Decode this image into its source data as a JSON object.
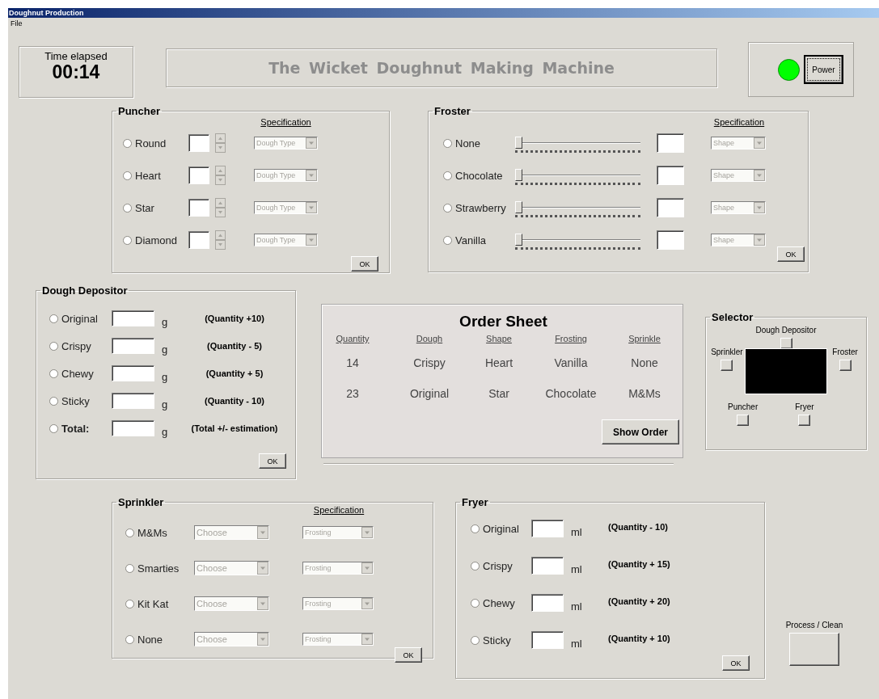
{
  "window": {
    "title": "Doughnut Production"
  },
  "menu": [
    "File"
  ],
  "timer": {
    "label": "Time elapsed",
    "value": "00:14"
  },
  "banner": {
    "title": "The Wicket Doughnut Making Machine"
  },
  "power": {
    "on": true,
    "button": "Power"
  },
  "puncher": {
    "title": "Puncher",
    "spec_heading": "Specification",
    "ok": "OK",
    "rows": [
      {
        "label": "Round",
        "checked": false,
        "dropdown": {
          "value": "Dough Type",
          "disabled": true
        }
      },
      {
        "label": "Heart",
        "checked": false,
        "dropdown": {
          "value": "Dough Type",
          "disabled": true
        }
      },
      {
        "label": "Star",
        "checked": false,
        "dropdown": {
          "value": "Dough Type",
          "disabled": true
        }
      },
      {
        "label": "Diamond",
        "checked": false,
        "dropdown": {
          "value": "Dough Type",
          "disabled": true
        }
      }
    ]
  },
  "froster": {
    "title": "Froster",
    "spec_heading": "Specification",
    "ok": "OK",
    "rows": [
      {
        "label": "None",
        "checked": false,
        "level": 0,
        "dropdown": {
          "value": "Shape",
          "disabled": true
        }
      },
      {
        "label": "Chocolate",
        "checked": false,
        "level": 0,
        "dropdown": {
          "value": "Shape",
          "disabled": true
        }
      },
      {
        "label": "Strawberry",
        "checked": false,
        "level": 0,
        "dropdown": {
          "value": "Shape",
          "disabled": true
        }
      },
      {
        "label": "Vanilla",
        "checked": false,
        "level": 0,
        "dropdown": {
          "value": "Shape",
          "disabled": true
        }
      }
    ]
  },
  "dough_depositor": {
    "title": "Dough Depositor",
    "ok": "OK",
    "rows": [
      {
        "kind": "item",
        "label": "Original",
        "checked": false,
        "unit": "g",
        "note": "(Quantity +10)"
      },
      {
        "kind": "item",
        "label": "Crispy",
        "checked": false,
        "unit": "g",
        "note": "(Quantity - 5)"
      },
      {
        "kind": "item",
        "label": "Chewy",
        "checked": false,
        "unit": "g",
        "note": "(Quantity + 5)"
      },
      {
        "kind": "item",
        "label": "Sticky",
        "checked": false,
        "unit": "g",
        "note": "(Quantity - 10)"
      },
      {
        "kind": "total",
        "label": "Total:",
        "checked": false,
        "unit": "g",
        "note": "(Total +/- estimation)"
      }
    ]
  },
  "order_sheet": {
    "title": "Order Sheet",
    "columns": [
      "Quantity",
      "Dough",
      "Shape",
      "Frosting",
      "Sprinkle"
    ],
    "rows": [
      [
        "14",
        "Crispy",
        "Heart",
        "Vanilla",
        "None"
      ],
      [
        "23",
        "Original",
        "Star",
        "Chocolate",
        "M&Ms"
      ]
    ],
    "button": "Show Order"
  },
  "selector": {
    "title": "Selector",
    "items": [
      {
        "label": "Dough Depositor"
      },
      {
        "label": "Sprinkler"
      },
      {
        "label": "Froster"
      },
      {
        "label": "Puncher"
      },
      {
        "label": "Fryer"
      }
    ]
  },
  "sprinkler": {
    "title": "Sprinkler",
    "spec_heading": "Specification",
    "ok": "OK",
    "rows": [
      {
        "label": "M&Ms",
        "checked": false,
        "choice": {
          "value": "Choose",
          "disabled": true
        },
        "spec": {
          "value": "Frosting",
          "disabled": true
        }
      },
      {
        "label": "Smarties",
        "checked": false,
        "choice": {
          "value": "Choose",
          "disabled": true
        },
        "spec": {
          "value": "Frosting",
          "disabled": true
        }
      },
      {
        "label": "Kit Kat",
        "checked": false,
        "choice": {
          "value": "Choose",
          "disabled": true
        },
        "spec": {
          "value": "Frosting",
          "disabled": true
        }
      },
      {
        "label": "None",
        "checked": false,
        "choice": {
          "value": "Choose",
          "disabled": true
        },
        "spec": {
          "value": "Frosting",
          "disabled": true
        }
      }
    ]
  },
  "fryer": {
    "title": "Fryer",
    "ok": "OK",
    "rows": [
      {
        "label": "Original",
        "checked": false,
        "unit": "ml",
        "note": "(Quantity - 10)"
      },
      {
        "label": "Crispy",
        "checked": false,
        "unit": "ml",
        "note": "(Quantity + 15)"
      },
      {
        "label": "Chewy",
        "checked": false,
        "unit": "ml",
        "note": "(Quantity + 20)"
      },
      {
        "label": "Sticky",
        "checked": false,
        "unit": "ml",
        "note": "(Quantity + 10)"
      }
    ]
  },
  "process": {
    "label": "Process / Clean"
  }
}
